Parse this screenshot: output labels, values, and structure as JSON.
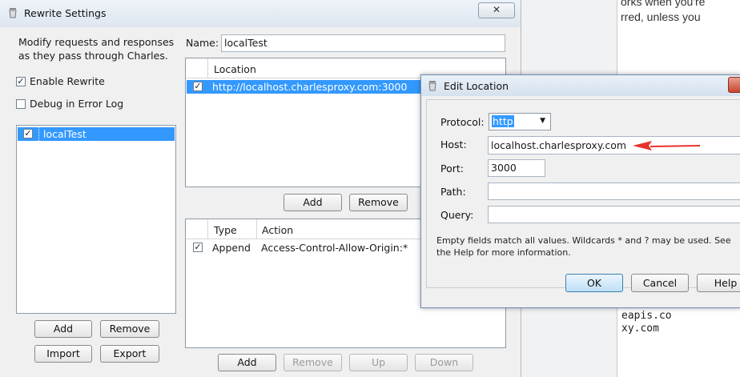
{
  "background_page": {
    "text_line1": "orks when you're",
    "text_line2": "rred, unless you",
    "code_line1": "eapis.co",
    "code_line2": "xy.com"
  },
  "rewrite_window": {
    "title": "Rewrite Settings",
    "close_label": "✕",
    "description": "Modify requests and responses as they pass through Charles.",
    "enable_rewrite_label": "Enable Rewrite",
    "enable_rewrite_checked": true,
    "debug_label": "Debug in Error Log",
    "debug_checked": false,
    "sets": [
      {
        "name": "localTest",
        "checked": true,
        "selected": true
      }
    ],
    "set_buttons": {
      "add": "Add",
      "remove": "Remove",
      "import": "Import",
      "export": "Export"
    },
    "name_label": "Name:",
    "name_value": "localTest",
    "locations_header": "Location",
    "locations": [
      {
        "location": "http://localhost.charlesproxy.com:3000",
        "checked": true,
        "selected": true
      }
    ],
    "location_buttons": {
      "add": "Add",
      "remove": "Remove"
    },
    "rules_headers": {
      "type": "Type",
      "action": "Action"
    },
    "rules": [
      {
        "type": "Append",
        "action": "Access-Control-Allow-Origin:*",
        "checked": true
      }
    ],
    "rule_buttons": {
      "add": "Add",
      "remove": "Remove",
      "up": "Up",
      "down": "Down"
    }
  },
  "edit_location": {
    "title": "Edit Location",
    "protocol_label": "Protocol:",
    "protocol_value": "http",
    "host_label": "Host:",
    "host_value": "localhost.charlesproxy.com",
    "port_label": "Port:",
    "port_value": "3000",
    "path_label": "Path:",
    "path_value": "",
    "query_label": "Query:",
    "query_value": "",
    "note": "Empty fields match all values. Wildcards * and ? may be used. See the Help for more information.",
    "ok_label": "OK",
    "cancel_label": "Cancel",
    "help_label": "Help"
  },
  "colors": {
    "selection": "#3399ff",
    "annotation_arrow": "#e8322e",
    "title_bar": "#dde6ef"
  }
}
